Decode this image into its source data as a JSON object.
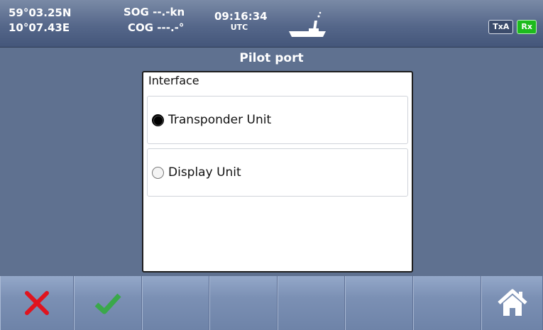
{
  "status": {
    "latitude": "59°03.25N",
    "longitude": "10°07.43E",
    "sog": "SOG --.-kn",
    "cog": "COG ---.-°",
    "time": "09:16:34",
    "timezone": "UTC",
    "tx_badge": "TxA",
    "rx_badge": "Rx"
  },
  "page": {
    "title": "Pilot port"
  },
  "dialog": {
    "header": "Interface",
    "options": [
      {
        "label": "Transponder Unit",
        "selected": true
      },
      {
        "label": "Display Unit",
        "selected": false
      }
    ]
  },
  "softkeys": [
    "cancel-icon",
    "confirm-icon",
    "",
    "",
    "",
    "",
    "",
    "home-icon"
  ],
  "colors": {
    "cancel": "#e0141e",
    "confirm": "#3aa84a",
    "rx_active": "#1dbb1d"
  }
}
